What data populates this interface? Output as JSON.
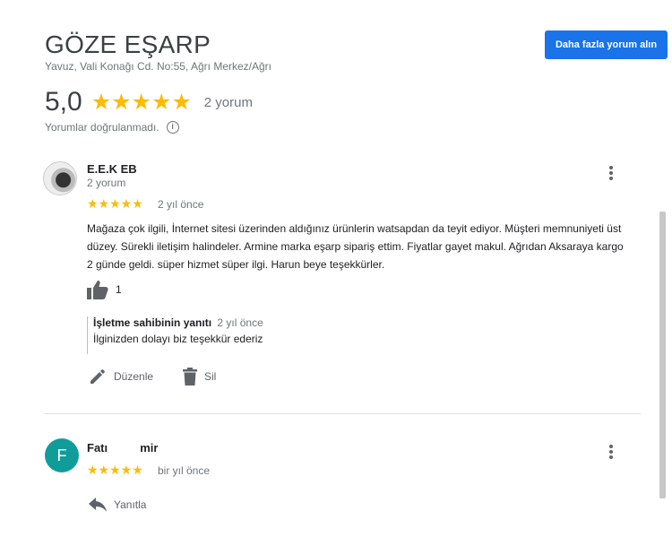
{
  "business": {
    "name": "GÖZE EŞARP",
    "address": "Yavuz, Vali Konağı Cd. No:55, Ağrı Merkez/Ağrı",
    "more_reviews_label": "Daha fazla yorum alın",
    "rating": "5,0",
    "stars": "★★★★★",
    "review_count": "2 yorum",
    "unverified_note": "Yorumlar doğrulanmadı.",
    "info_icon": "i"
  },
  "reviews": [
    {
      "author": "E.E.K EB",
      "author_sub": "2 yorum",
      "stars": "★★★★★",
      "time": "2 yıl önce",
      "text": "Mağaza çok ilgili, İnternet sitesi üzerinden aldığınız ürünlerin watsapdan da teyit ediyor. Müşteri memnuniyeti üst düzey. Sürekli iletişim halindeler. Armine marka eşarp sipariş ettim. Fiyatlar gayet makul. Ağrıdan  Aksaraya kargo 2 günde geldi. süper hizmet süper ilgi. Harun beye teşekkürler.",
      "likes": "1",
      "owner_reply": {
        "title": "İşletme sahibinin yanıtı",
        "time": "2 yıl önce",
        "text": "İlginizden dolayı biz teşekkür ederiz"
      },
      "edit_label": "Düzenle",
      "delete_label": "Sil"
    },
    {
      "avatar_letter": "F",
      "author": "Fatı          mir",
      "stars": "★★★★★",
      "time": "bir yıl önce",
      "reply_label": "Yanıtla"
    }
  ],
  "colors": {
    "accent": "#1a73e8",
    "star": "#fbbc04",
    "avatar_f": "#109d99"
  }
}
